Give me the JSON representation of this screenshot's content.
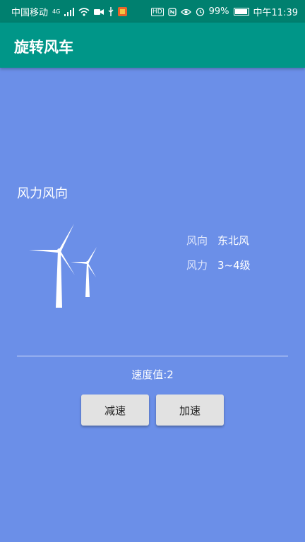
{
  "status_bar": {
    "carrier": "中国移动",
    "network": "4G",
    "hd_badge": "HD",
    "battery": "99%",
    "time": "中午11:39"
  },
  "app_bar": {
    "title": "旋转风车"
  },
  "section": {
    "title": "风力风向"
  },
  "wind_info": {
    "direction_label": "风向",
    "direction_value": "东北风",
    "force_label": "风力",
    "force_value": "3~4级"
  },
  "speed": {
    "text": "速度值:2"
  },
  "buttons": {
    "slow_down": "减速",
    "speed_up": "加速"
  },
  "colors": {
    "background": "#6b8fe8",
    "app_bar": "#009688",
    "status_bar": "#00806f",
    "button": "#e2e2e2"
  }
}
